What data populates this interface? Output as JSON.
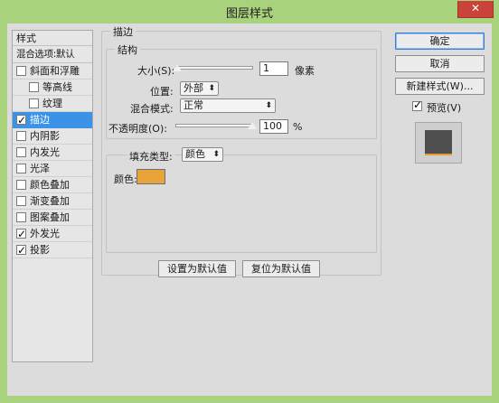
{
  "window": {
    "title": "图层样式",
    "close_glyph": "✕"
  },
  "styles_list": {
    "header": "样式",
    "blend_options": "混合选项:默认",
    "items": [
      {
        "label": "斜面和浮雕",
        "checked": false,
        "indent": false,
        "active": false
      },
      {
        "label": "等高线",
        "checked": false,
        "indent": true,
        "active": false
      },
      {
        "label": "纹理",
        "checked": false,
        "indent": true,
        "active": false
      },
      {
        "label": "描边",
        "checked": true,
        "indent": false,
        "active": true
      },
      {
        "label": "内阴影",
        "checked": false,
        "indent": false,
        "active": false
      },
      {
        "label": "内发光",
        "checked": false,
        "indent": false,
        "active": false
      },
      {
        "label": "光泽",
        "checked": false,
        "indent": false,
        "active": false
      },
      {
        "label": "颜色叠加",
        "checked": false,
        "indent": false,
        "active": false
      },
      {
        "label": "渐变叠加",
        "checked": false,
        "indent": false,
        "active": false
      },
      {
        "label": "图案叠加",
        "checked": false,
        "indent": false,
        "active": false
      },
      {
        "label": "外发光",
        "checked": true,
        "indent": false,
        "active": false
      },
      {
        "label": "投影",
        "checked": true,
        "indent": false,
        "active": false
      }
    ]
  },
  "stroke_panel": {
    "title": "描边",
    "structure": {
      "title": "结构",
      "size_label": "大小(S):",
      "size_value": "1",
      "size_unit": "像素",
      "position_label": "位置:",
      "position_value": "外部",
      "blend_label": "混合模式:",
      "blend_value": "正常",
      "opacity_label": "不透明度(O):",
      "opacity_value": "100",
      "opacity_unit": "%"
    },
    "fill": {
      "type_label": "填充类型:",
      "type_value": "颜色",
      "color_label": "颜色:",
      "color_hex": "#e8a43a"
    },
    "make_default": "设置为默认值",
    "reset_default": "复位为默认值"
  },
  "right_panel": {
    "ok": "确定",
    "cancel": "取消",
    "new_style": "新建样式(W)...",
    "preview_label": "预览(V)",
    "preview_checked": true
  }
}
